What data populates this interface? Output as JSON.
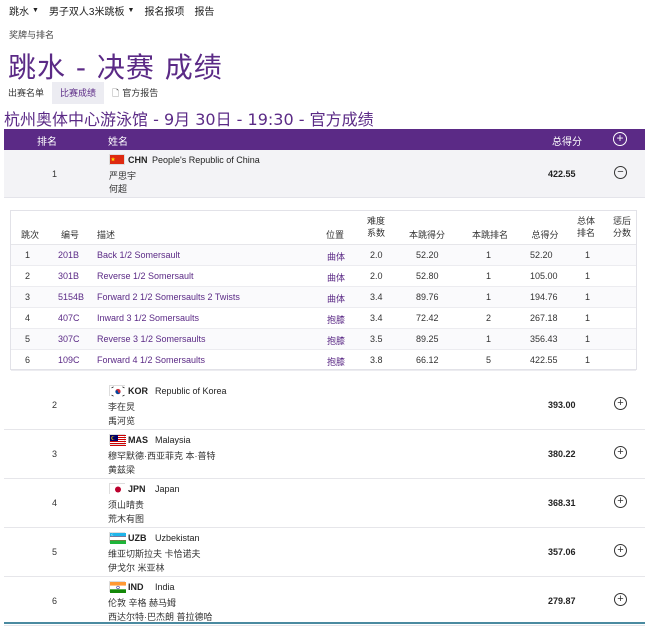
{
  "topnav": [
    {
      "label": "跳水",
      "caret": true
    },
    {
      "label": "男子双人3米跳板",
      "caret": true
    },
    {
      "label": "报名报项",
      "caret": false
    },
    {
      "label": "报告",
      "caret": false
    }
  ],
  "breadcrumb": "奖牌与排名",
  "title": "跳水 - 决赛 成绩",
  "subtabs": [
    {
      "label": "出赛名单",
      "active": false
    },
    {
      "label": "比赛成绩",
      "active": true
    },
    {
      "label": "官方报告",
      "active": false
    }
  ],
  "venue": "杭州奥体中心游泳馆 - 9月 30日 - 19:30 - 官方成绩",
  "table_header": {
    "rank": "排名",
    "name": "姓名",
    "total": "总得分"
  },
  "results": [
    {
      "rank": "1",
      "code": "CHN",
      "country": "People's Republic of China",
      "athletes": [
        "严思宇",
        "何超"
      ],
      "total": "422.55",
      "expanded": true
    },
    {
      "rank": "2",
      "code": "KOR",
      "country": "Republic of Korea",
      "athletes": [
        "李在炅",
        "禹河览"
      ],
      "total": "393.00",
      "expanded": false
    },
    {
      "rank": "3",
      "code": "MAS",
      "country": "Malaysia",
      "athletes": [
        "穆罕默德·西亚菲克 本·普特",
        "黄兹梁"
      ],
      "total": "380.22",
      "expanded": false
    },
    {
      "rank": "4",
      "code": "JPN",
      "country": "Japan",
      "athletes": [
        "须山晴贵",
        "荒木有图"
      ],
      "total": "368.31",
      "expanded": false
    },
    {
      "rank": "5",
      "code": "UZB",
      "country": "Uzbekistan",
      "athletes": [
        "维亚切斯拉夫 卡恰诺夫",
        "伊戈尔 米亚林"
      ],
      "total": "357.06",
      "expanded": false
    },
    {
      "rank": "6",
      "code": "IND",
      "country": "India",
      "athletes": [
        "伦敦 辛格 赫马姆",
        "西达尔特·巴杰朗 普拉德哈"
      ],
      "total": "279.87",
      "expanded": false
    }
  ],
  "detail_header": {
    "round": "跳次",
    "code": "编号",
    "desc": "描述",
    "position": "位置",
    "difficulty": "难度\n系数",
    "jump_score": "本跳得分",
    "jump_rank": "本跳排名",
    "total": "总得分",
    "total_rank": "总体\n排名",
    "penalty": "惩后\n分数"
  },
  "dives": [
    {
      "round": "1",
      "code": "201B",
      "desc": "Back 1/2 Somersault",
      "position": "曲体",
      "dd": "2.0",
      "score": "52.20",
      "jrank": "1",
      "total": "52.20",
      "trank": "1"
    },
    {
      "round": "2",
      "code": "301B",
      "desc": "Reverse 1/2 Somersault",
      "position": "曲体",
      "dd": "2.0",
      "score": "52.80",
      "jrank": "1",
      "total": "105.00",
      "trank": "1"
    },
    {
      "round": "3",
      "code": "5154B",
      "desc": "Forward 2 1/2 Somersaults 2 Twists",
      "position": "曲体",
      "dd": "3.4",
      "score": "89.76",
      "jrank": "1",
      "total": "194.76",
      "trank": "1"
    },
    {
      "round": "4",
      "code": "407C",
      "desc": "Inward 3 1/2 Somersaults",
      "position": "抱膝",
      "dd": "3.4",
      "score": "72.42",
      "jrank": "2",
      "total": "267.18",
      "trank": "1"
    },
    {
      "round": "5",
      "code": "307C",
      "desc": "Reverse 3 1/2 Somersaults",
      "position": "抱膝",
      "dd": "3.5",
      "score": "89.25",
      "jrank": "1",
      "total": "356.43",
      "trank": "1"
    },
    {
      "round": "6",
      "code": "109C",
      "desc": "Forward 4 1/2 Somersaults",
      "position": "抱膝",
      "dd": "3.8",
      "score": "66.12",
      "jrank": "5",
      "total": "422.55",
      "trank": "1"
    }
  ],
  "colors": {
    "brand": "#5b2a86",
    "row_alt": "#f3f3f6",
    "bottom_rule": "#4a8aa0"
  }
}
